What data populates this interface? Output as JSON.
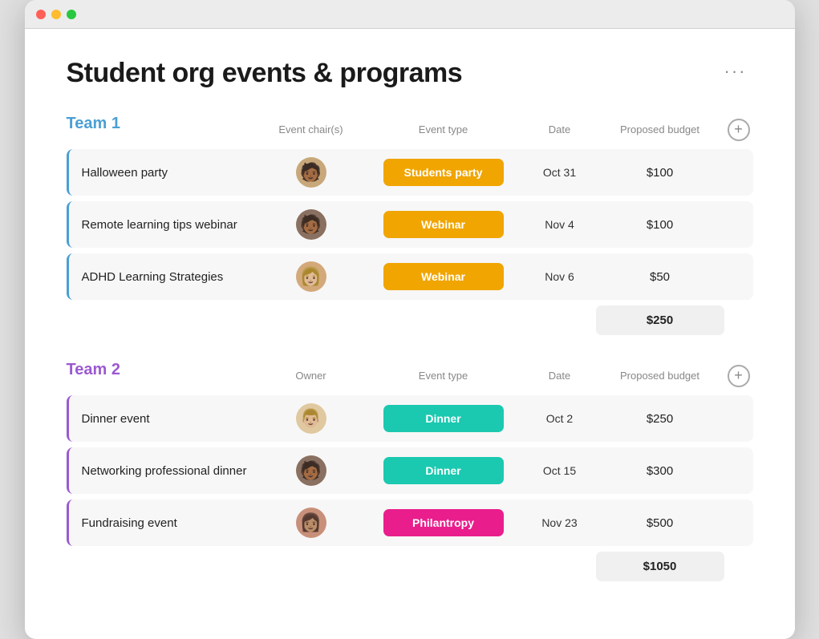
{
  "window": {
    "title": "Student org events & programs"
  },
  "page": {
    "title": "Student org events & programs",
    "more_label": "···"
  },
  "team1": {
    "name": "Team 1",
    "header": {
      "col1": "",
      "col_chair": "Event chair(s)",
      "col_type": "Event type",
      "col_date": "Date",
      "col_budget": "Proposed budget"
    },
    "rows": [
      {
        "name": "Halloween party",
        "avatar": "👩🏾",
        "type": "Students party",
        "type_class": "badge-students-party",
        "date": "Oct 31",
        "budget": "$100"
      },
      {
        "name": "Remote learning tips webinar",
        "avatar": "👨🏾",
        "type": "Webinar",
        "type_class": "badge-webinar",
        "date": "Nov 4",
        "budget": "$100"
      },
      {
        "name": "ADHD Learning Strategies",
        "avatar": "👩🏼",
        "type": "Webinar",
        "type_class": "badge-webinar",
        "date": "Nov 6",
        "budget": "$50"
      }
    ],
    "total": "$250"
  },
  "team2": {
    "name": "Team 2",
    "header": {
      "col1": "",
      "col_chair": "Owner",
      "col_type": "Event type",
      "col_date": "Date",
      "col_budget": "Proposed budget"
    },
    "rows": [
      {
        "name": "Dinner event",
        "avatar": "👨🏼",
        "type": "Dinner",
        "type_class": "badge-dinner",
        "date": "Oct 2",
        "budget": "$250"
      },
      {
        "name": "Networking professional dinner",
        "avatar": "👨🏾",
        "type": "Dinner",
        "type_class": "badge-dinner",
        "date": "Oct 15",
        "budget": "$300"
      },
      {
        "name": "Fundraising event",
        "avatar": "👩🏽",
        "type": "Philantropy",
        "type_class": "badge-philanthropy",
        "date": "Nov 23",
        "budget": "$500"
      }
    ],
    "total": "$1050"
  }
}
